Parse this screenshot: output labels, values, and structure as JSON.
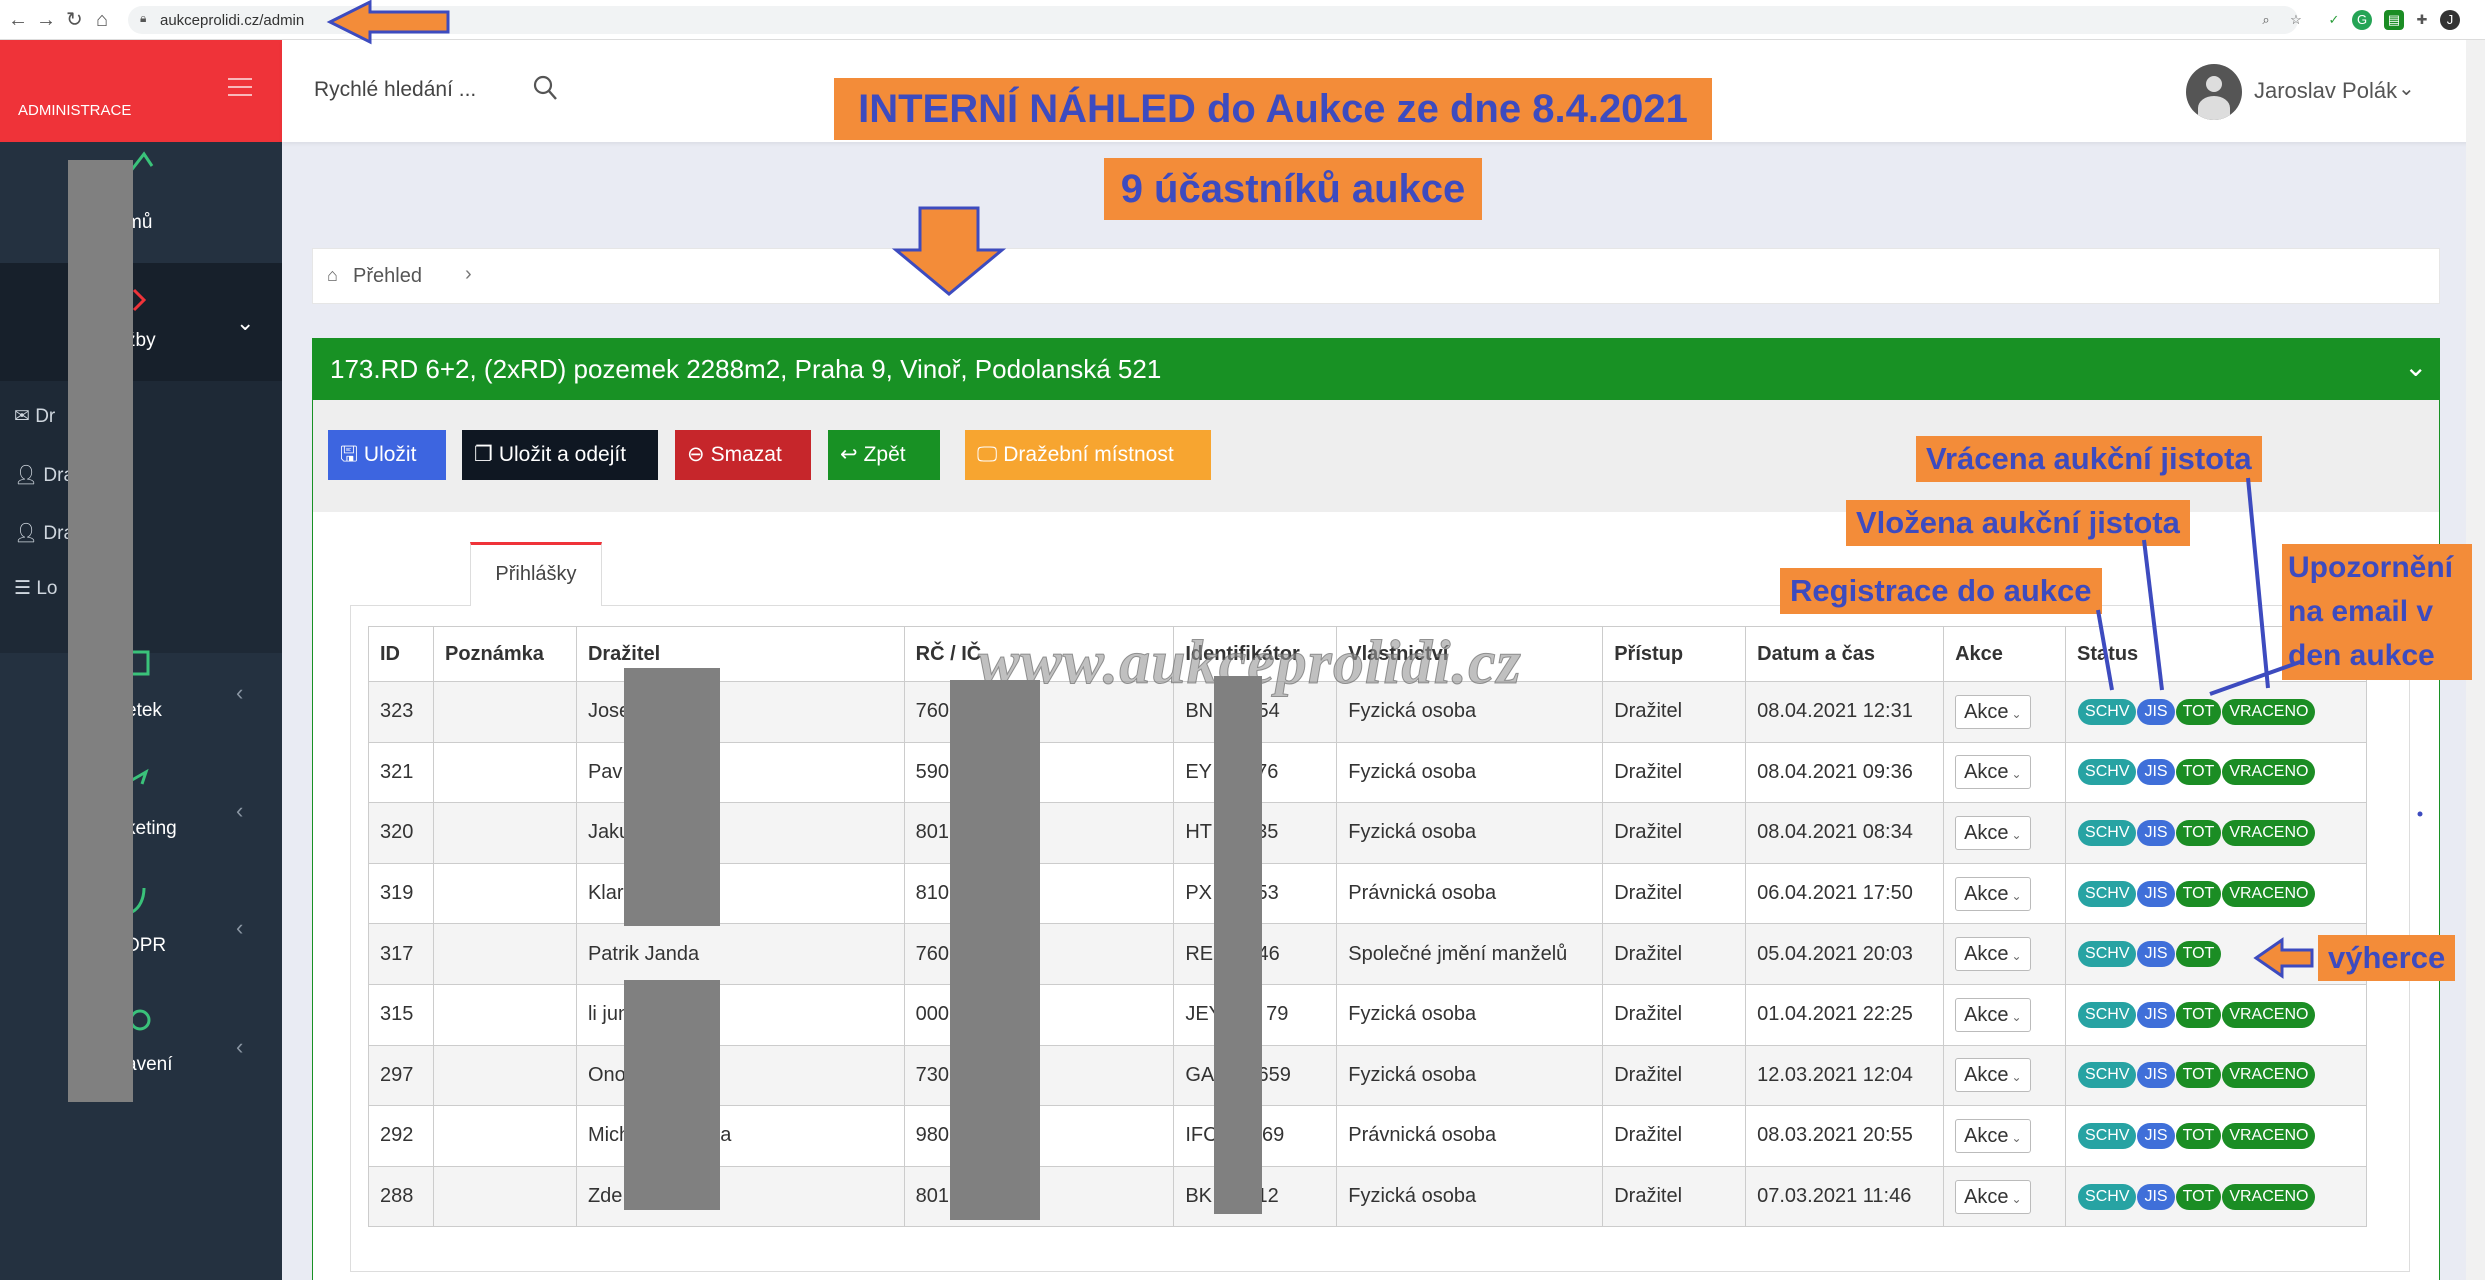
{
  "browser": {
    "url": "aukceprolidi.cz/admin"
  },
  "sidebar": {
    "brand": "ADMINISTRACE",
    "items": [
      {
        "label": "mů"
      },
      {
        "label": "žby"
      },
      {
        "label": "etek"
      },
      {
        "label": "keting"
      },
      {
        "label": "DPR"
      },
      {
        "label": "avení"
      }
    ],
    "subitems": [
      {
        "label": "Dr"
      },
      {
        "label": "Dra"
      },
      {
        "label": "Dra          i"
      },
      {
        "label": "Lo          stí"
      }
    ]
  },
  "topbar": {
    "search_placeholder": "Rychlé hledání ...",
    "user_name": "Jaroslav Polák"
  },
  "annotations": {
    "banner_title": "INTERNÍ NÁHLED do Aukce ze dne 8.4.2021",
    "banner_participants": "9 účastníků aukce",
    "returned_deposit": "Vrácena aukční jistota",
    "deposit_paid": "Vložena aukční jistota",
    "registration": "Registrace do aukce",
    "email_notice_1": "Upozornění",
    "email_notice_2": "na email v",
    "email_notice_3": "den aukce",
    "winner": "výherce",
    "watermark": "www.aukceprolidi.cz"
  },
  "breadcrumb": {
    "label": "Přehled"
  },
  "card": {
    "title": "173.RD 6+2, (2xRD) pozemek 2288m2, Praha 9, Vinoř, Podolanská 521",
    "buttons": {
      "save": "Uložit",
      "save_exit": "Uložit a odejít",
      "delete": "Smazat",
      "back": "Zpět",
      "auction_room": "Dražební místnost"
    },
    "tab": "Přihlášky"
  },
  "table": {
    "headers": [
      "ID",
      "Poznámka",
      "Dražitel",
      "RČ / IČ",
      "Identifikátor",
      "Vlastnictví",
      "Přístup",
      "Datum a čas",
      "Akce",
      "Status"
    ],
    "action_label": "Akce",
    "pills": {
      "schv": "SCHV",
      "jis": "JIS",
      "tot": "TOT",
      "vrac": "VRACENO"
    },
    "rows": [
      {
        "id": "323",
        "note": "",
        "bidder": "Jose",
        "rc": "760",
        "ident": "BN        54",
        "ownership": "Fyzická osoba",
        "access": "Dražitel",
        "date": "08.04.2021 12:31",
        "returned": true
      },
      {
        "id": "321",
        "note": "",
        "bidder": "Pav          ček",
        "rc": "590",
        "ident": "EY        76",
        "ownership": "Fyzická osoba",
        "access": "Dražitel",
        "date": "08.04.2021 09:36",
        "returned": true
      },
      {
        "id": "320",
        "note": "",
        "bidder": "Jaku",
        "rc": "801",
        "ident": "HT        35",
        "ownership": "Fyzická osoba",
        "access": "Dražitel",
        "date": "08.04.2021 08:34",
        "returned": true
      },
      {
        "id": "319",
        "note": "",
        "bidder": "Klar          ová",
        "rc": "810",
        "ident": "PX        53",
        "ownership": "Právnická osoba",
        "access": "Dražitel",
        "date": "06.04.2021 17:50",
        "returned": true
      },
      {
        "id": "317",
        "note": "",
        "bidder": "Patrik Janda",
        "rc": "760",
        "ident": "RE        46",
        "ownership": "Společné jmění manželů",
        "access": "Dražitel",
        "date": "05.04.2021 20:03",
        "returned": false
      },
      {
        "id": "315",
        "note": "",
        "bidder": "li jun",
        "rc": "000",
        "ident": "JEY        79",
        "ownership": "Fyzická osoba",
        "access": "Dražitel",
        "date": "01.04.2021 22:25",
        "returned": true
      },
      {
        "id": "297",
        "note": "",
        "bidder": "Ono          dl",
        "rc": "730",
        "ident": "GA        659",
        "ownership": "Fyzická osoba",
        "access": "Dražitel",
        "date": "12.03.2021 12:04",
        "returned": true
      },
      {
        "id": "292",
        "note": "",
        "bidder": "Mich          etera",
        "rc": "980",
        "ident": "IFC        69",
        "ownership": "Právnická osoba",
        "access": "Dražitel",
        "date": "08.03.2021 20:55",
        "returned": true
      },
      {
        "id": "288",
        "note": "",
        "bidder": "Zde          ová",
        "rc": "801",
        "ident": "BK        12",
        "ownership": "Fyzická osoba",
        "access": "Dražitel",
        "date": "07.03.2021 11:46",
        "returned": true
      }
    ]
  },
  "colors": {
    "sidebar_bg": "#243140",
    "brand_red": "#ef3339",
    "card_green": "#189124",
    "annotation_orange": "#f38c39",
    "annotation_text": "#3d4bbf"
  }
}
